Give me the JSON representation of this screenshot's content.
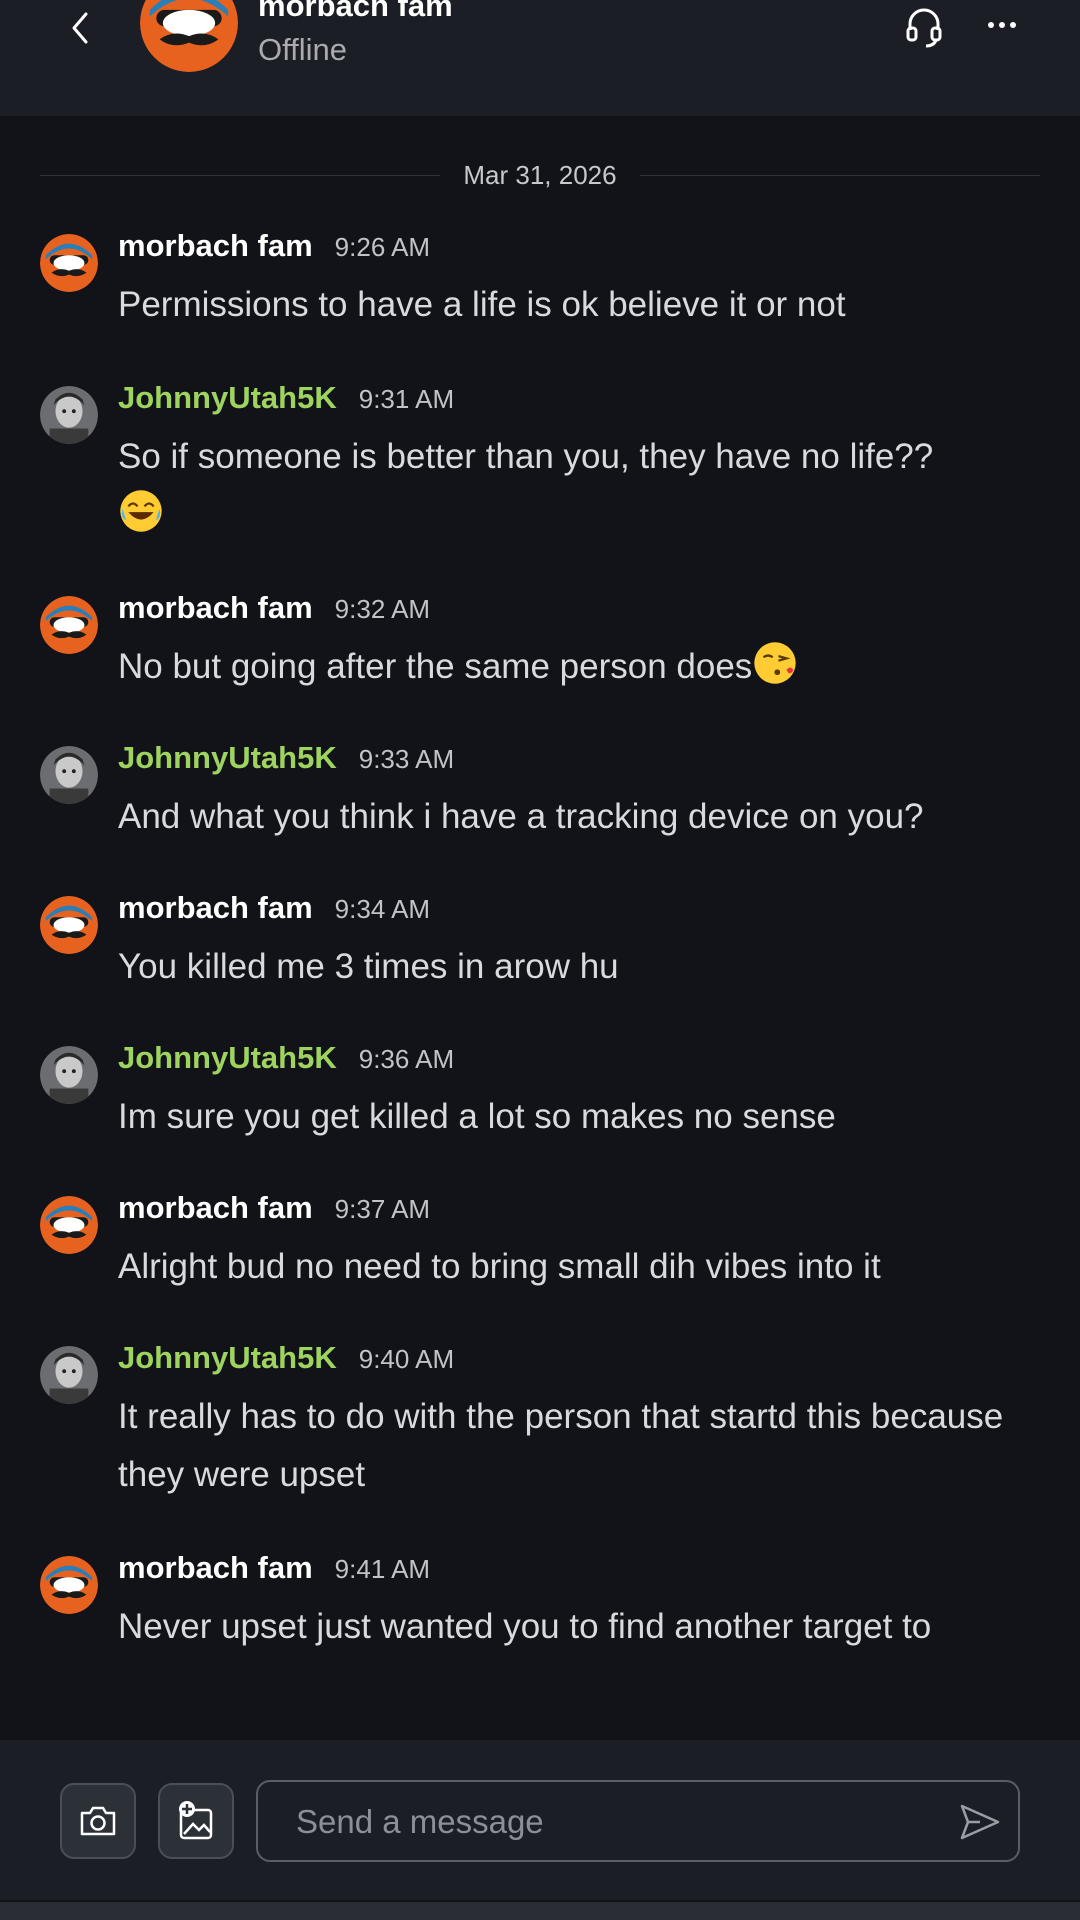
{
  "header": {
    "contact_name": "morbach fam",
    "status": "Offline"
  },
  "date_divider": "Mar 31, 2026",
  "messages": [
    {
      "author": "morbach fam",
      "time": "9:26 AM",
      "text": "Permissions to have a life is ok believe it or not"
    },
    {
      "author": "JohnnyUtah5K",
      "time": "9:31 AM",
      "text": "So if someone is better than you, they have no life??"
    },
    {
      "author": "morbach fam",
      "time": "9:32 AM",
      "text": "No but going after the same person does"
    },
    {
      "author": "JohnnyUtah5K",
      "time": "9:33 AM",
      "text": "And what you think i have a tracking device on you?"
    },
    {
      "author": "morbach fam",
      "time": "9:34 AM",
      "text": "You killed me 3 times in arow hu"
    },
    {
      "author": "JohnnyUtah5K",
      "time": "9:36 AM",
      "text": "Im sure you get killed a lot so makes no sense"
    },
    {
      "author": "morbach fam",
      "time": "9:37 AM",
      "text": "Alright bud no need to bring small dih vibes into it"
    },
    {
      "author": "JohnnyUtah5K",
      "time": "9:40 AM",
      "text": "It really has to do with the person that startd this because they were upset"
    },
    {
      "author": "morbach fam",
      "time": "9:41 AM",
      "text": "Never upset just wanted you to find another target to"
    }
  ],
  "composer": {
    "placeholder": "Send a message"
  },
  "colors": {
    "background": "#111318",
    "header": "#1b1e24",
    "other_user_name": "#9ed35f",
    "self_name": "#ffffff"
  },
  "icons": [
    "back-chevron-icon",
    "headset-icon",
    "more-dots-icon",
    "camera-icon",
    "add-image-icon",
    "send-icon",
    "laughing-emoji-icon",
    "kiss-emoji-icon"
  ]
}
